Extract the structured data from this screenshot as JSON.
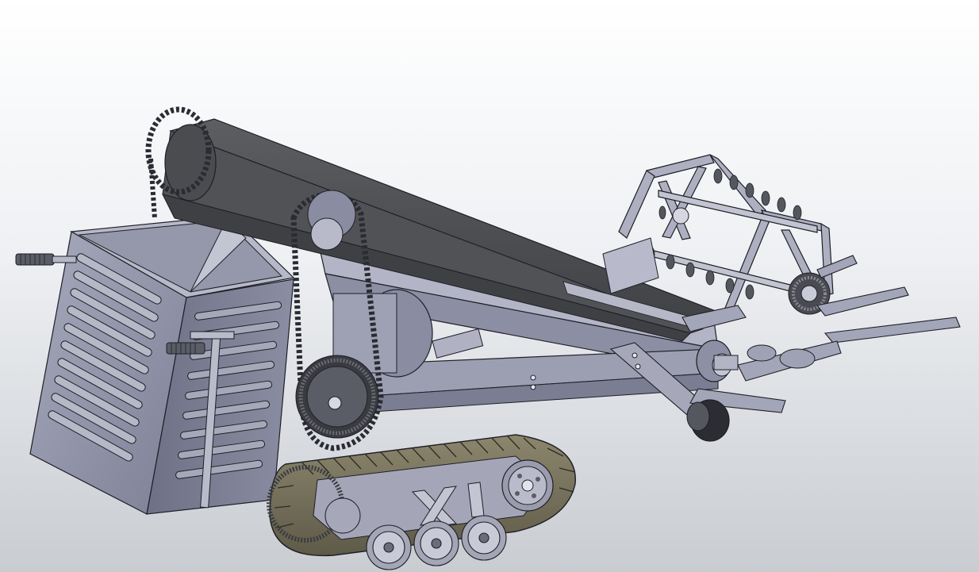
{
  "viewport": {
    "background_top": "#ffffff",
    "background_bottom": "#c9ccd1"
  },
  "model": {
    "body_color": "#8d90a4",
    "body_dark": "#6e7186",
    "body_light": "#b8bacb",
    "conveyor_color": "#4f5154",
    "track_color": "#7a7560",
    "edge_color": "#1e1f26"
  }
}
